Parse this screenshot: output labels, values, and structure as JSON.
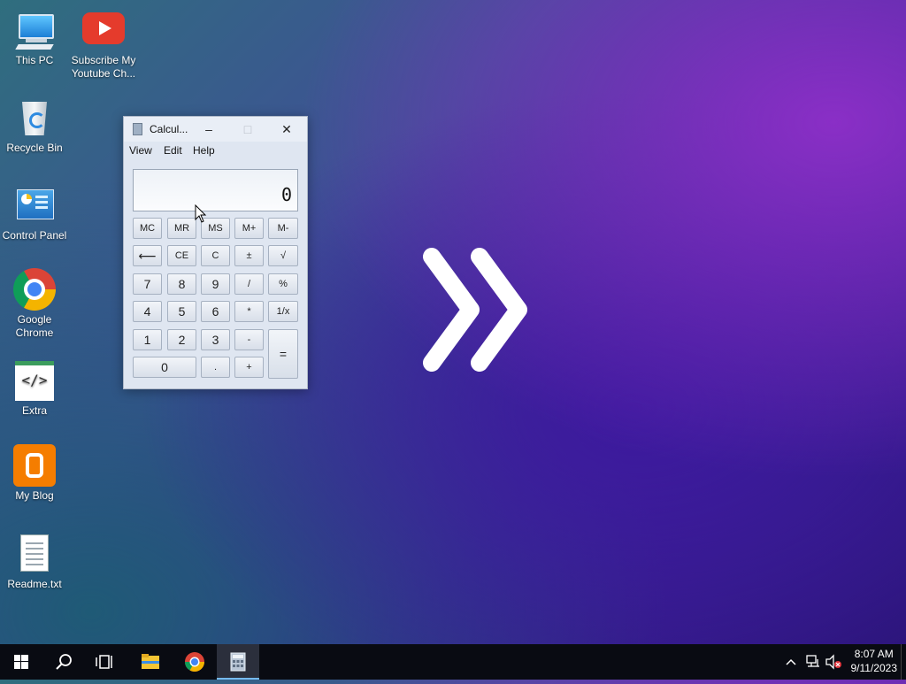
{
  "desktop": {
    "icons": [
      {
        "label": "This PC",
        "icon": "computer-icon"
      },
      {
        "label": "Subscribe My Youtube Ch...",
        "icon": "youtube-icon"
      },
      {
        "label": "Recycle Bin",
        "icon": "recycle-bin-icon"
      },
      {
        "label": "Control Panel",
        "icon": "control-panel-icon"
      },
      {
        "label": "Google Chrome",
        "icon": "chrome-icon"
      },
      {
        "label": "Extra",
        "icon": "code-file-icon"
      },
      {
        "label": "My Blog",
        "icon": "blogger-icon"
      },
      {
        "label": "Readme.txt",
        "icon": "text-file-icon"
      }
    ]
  },
  "calculator": {
    "title": "Calcul...",
    "menu": [
      "View",
      "Edit",
      "Help"
    ],
    "display": "0",
    "memory_row": [
      "MC",
      "MR",
      "MS",
      "M+",
      "M-"
    ],
    "row2": [
      "⟵",
      "CE",
      "C",
      "±",
      "√"
    ],
    "row3": [
      "7",
      "8",
      "9",
      "/",
      "%"
    ],
    "row4": [
      "4",
      "5",
      "6",
      "*",
      "1/x"
    ],
    "row5": [
      "1",
      "2",
      "3",
      "-"
    ],
    "row6": [
      "0",
      ".",
      "+"
    ],
    "equals": "="
  },
  "taskbar": {
    "buttons": [
      "start-icon",
      "search-icon",
      "task-view-icon",
      "file-explorer-icon",
      "chrome-icon",
      "calculator-icon"
    ],
    "active": "calculator-icon",
    "time": "8:07 AM",
    "date": "9/11/2023"
  },
  "colors": {
    "taskbar": "#090b12",
    "accent": "#76b9ed"
  }
}
